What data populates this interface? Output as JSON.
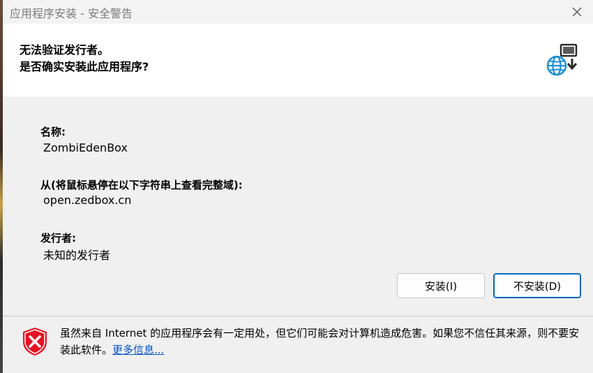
{
  "window": {
    "title": "应用程序安装 - 安全警告"
  },
  "header": {
    "line1": "无法验证发行者。",
    "line2": "是否确实安装此应用程序?"
  },
  "fields": {
    "name_label": "名称:",
    "name_value": "ZombiEdenBox",
    "from_label": "从(将鼠标悬停在以下字符串上查看完整域):",
    "from_value": "open.zedbox.cn",
    "publisher_label": "发行者:",
    "publisher_value": "未知的发行者"
  },
  "buttons": {
    "install": "安装(I)",
    "dont_install": "不安装(D)"
  },
  "footer": {
    "warning_text": "虽然来自 Internet 的应用程序会有一定用处，但它们可能会对计算机造成危害。如果您不信任其来源，则不要安装此软件。",
    "more_info_link": "更多信息..."
  },
  "colors": {
    "accent": "#0067c0",
    "shield_red": "#e81123",
    "globe_blue": "#1e90d6",
    "link": "#0052cc"
  },
  "icons": {
    "close": "close-icon",
    "header": "globe-install-icon",
    "footer": "shield-error-icon"
  }
}
